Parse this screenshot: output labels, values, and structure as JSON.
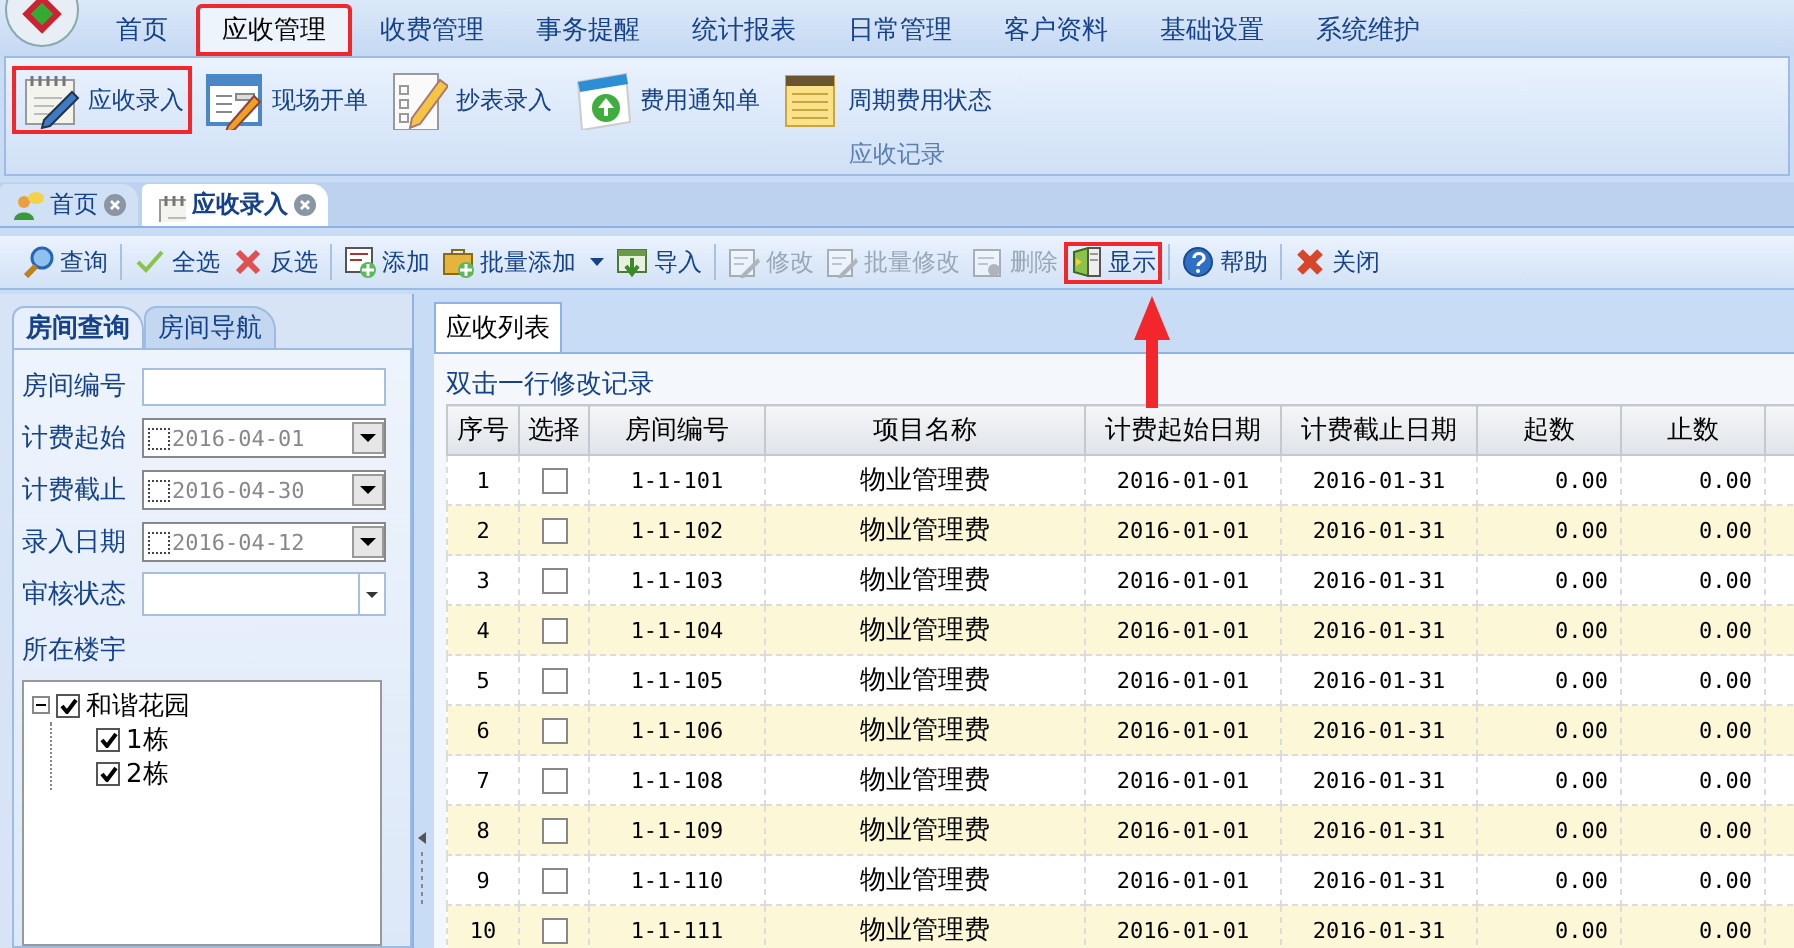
{
  "menu_tabs": [
    {
      "label": "首页",
      "selected": false,
      "highlighted": false
    },
    {
      "label": "应收管理",
      "selected": true,
      "highlighted": true
    },
    {
      "label": "收费管理",
      "selected": false,
      "highlighted": false
    },
    {
      "label": "事务提醒",
      "selected": false,
      "highlighted": false
    },
    {
      "label": "统计报表",
      "selected": false,
      "highlighted": false
    },
    {
      "label": "日常管理",
      "selected": false,
      "highlighted": false
    },
    {
      "label": "客户资料",
      "selected": false,
      "highlighted": false
    },
    {
      "label": "基础设置",
      "selected": false,
      "highlighted": false
    },
    {
      "label": "系统维护",
      "selected": false,
      "highlighted": false
    }
  ],
  "ribbon": {
    "group_label": "应收记录",
    "items": [
      {
        "label": "应收录入",
        "kind": "notepad",
        "highlighted": true
      },
      {
        "label": "现场开单",
        "kind": "form",
        "highlighted": false
      },
      {
        "label": "抄表录入",
        "kind": "checklist",
        "highlighted": false
      },
      {
        "label": "费用通知单",
        "kind": "notice",
        "highlighted": false
      },
      {
        "label": "周期费用状态",
        "kind": "ledger",
        "highlighted": false
      }
    ]
  },
  "doc_tabs": [
    {
      "label": "首页",
      "kind": "home",
      "selected": false
    },
    {
      "label": "应收录入",
      "kind": "notepad",
      "selected": true
    }
  ],
  "toolbar": [
    {
      "label": "查询",
      "kind": "search",
      "disabled": false,
      "highlighted": false
    },
    {
      "kind": "separator"
    },
    {
      "label": "全选",
      "kind": "tick",
      "disabled": false,
      "highlighted": false
    },
    {
      "label": "反选",
      "kind": "cross",
      "disabled": false,
      "highlighted": false
    },
    {
      "kind": "separator"
    },
    {
      "label": "添加",
      "kind": "add",
      "disabled": false,
      "highlighted": false
    },
    {
      "label": "批量添加",
      "kind": "batch",
      "disabled": false,
      "highlighted": false,
      "dropdown": true
    },
    {
      "label": "导入",
      "kind": "import",
      "disabled": false,
      "highlighted": false
    },
    {
      "kind": "separator"
    },
    {
      "label": "修改",
      "kind": "edit",
      "disabled": true,
      "highlighted": false
    },
    {
      "label": "批量修改",
      "kind": "edit",
      "disabled": true,
      "highlighted": false
    },
    {
      "label": "删除",
      "kind": "delete",
      "disabled": true,
      "highlighted": false
    },
    {
      "label": "显示",
      "kind": "display",
      "disabled": false,
      "highlighted": true
    },
    {
      "kind": "separator"
    },
    {
      "label": "帮助",
      "kind": "help",
      "disabled": false,
      "highlighted": false
    },
    {
      "kind": "separator"
    },
    {
      "label": "关闭",
      "kind": "close",
      "disabled": false,
      "highlighted": false
    }
  ],
  "left_panel": {
    "tabs": [
      {
        "label": "房间查询",
        "selected": true
      },
      {
        "label": "房间导航",
        "selected": false
      }
    ],
    "fields": [
      {
        "label": "房间编号",
        "kind": "text"
      },
      {
        "label": "计费起始",
        "kind": "date",
        "value": "2016-04-01",
        "checked": false
      },
      {
        "label": "计费截止",
        "kind": "date",
        "value": "2016-04-30",
        "checked": false
      },
      {
        "label": "录入日期",
        "kind": "date",
        "value": "2016-04-12",
        "checked": false
      },
      {
        "label": "审核状态",
        "kind": "combo"
      }
    ],
    "tree_label": "所在楼宇",
    "tree": [
      {
        "label": "和谐花园",
        "checked": true,
        "expanded": true,
        "children": [
          {
            "label": "1栋",
            "checked": true
          },
          {
            "label": "2栋",
            "checked": true
          }
        ]
      }
    ]
  },
  "content": {
    "tab": "应收列表",
    "hint": "双击一行修改记录",
    "columns": [
      "序号",
      "选择",
      "房间编号",
      "项目名称",
      "计费起始日期",
      "计费截止日期",
      "起数",
      "止数"
    ],
    "rows": [
      {
        "no": "1",
        "checked": false,
        "room": "1-1-101",
        "item": "物业管理费",
        "start": "2016-01-01",
        "end": "2016-01-31",
        "from": "0.00",
        "to": "0.00"
      },
      {
        "no": "2",
        "checked": false,
        "room": "1-1-102",
        "item": "物业管理费",
        "start": "2016-01-01",
        "end": "2016-01-31",
        "from": "0.00",
        "to": "0.00"
      },
      {
        "no": "3",
        "checked": false,
        "room": "1-1-103",
        "item": "物业管理费",
        "start": "2016-01-01",
        "end": "2016-01-31",
        "from": "0.00",
        "to": "0.00"
      },
      {
        "no": "4",
        "checked": false,
        "room": "1-1-104",
        "item": "物业管理费",
        "start": "2016-01-01",
        "end": "2016-01-31",
        "from": "0.00",
        "to": "0.00"
      },
      {
        "no": "5",
        "checked": false,
        "room": "1-1-105",
        "item": "物业管理费",
        "start": "2016-01-01",
        "end": "2016-01-31",
        "from": "0.00",
        "to": "0.00"
      },
      {
        "no": "6",
        "checked": false,
        "room": "1-1-106",
        "item": "物业管理费",
        "start": "2016-01-01",
        "end": "2016-01-31",
        "from": "0.00",
        "to": "0.00"
      },
      {
        "no": "7",
        "checked": false,
        "room": "1-1-108",
        "item": "物业管理费",
        "start": "2016-01-01",
        "end": "2016-01-31",
        "from": "0.00",
        "to": "0.00"
      },
      {
        "no": "8",
        "checked": false,
        "room": "1-1-109",
        "item": "物业管理费",
        "start": "2016-01-01",
        "end": "2016-01-31",
        "from": "0.00",
        "to": "0.00"
      },
      {
        "no": "9",
        "checked": false,
        "room": "1-1-110",
        "item": "物业管理费",
        "start": "2016-01-01",
        "end": "2016-01-31",
        "from": "0.00",
        "to": "0.00"
      },
      {
        "no": "10",
        "checked": false,
        "room": "1-1-111",
        "item": "物业管理费",
        "start": "2016-01-01",
        "end": "2016-01-31",
        "from": "0.00",
        "to": "0.00"
      }
    ]
  }
}
